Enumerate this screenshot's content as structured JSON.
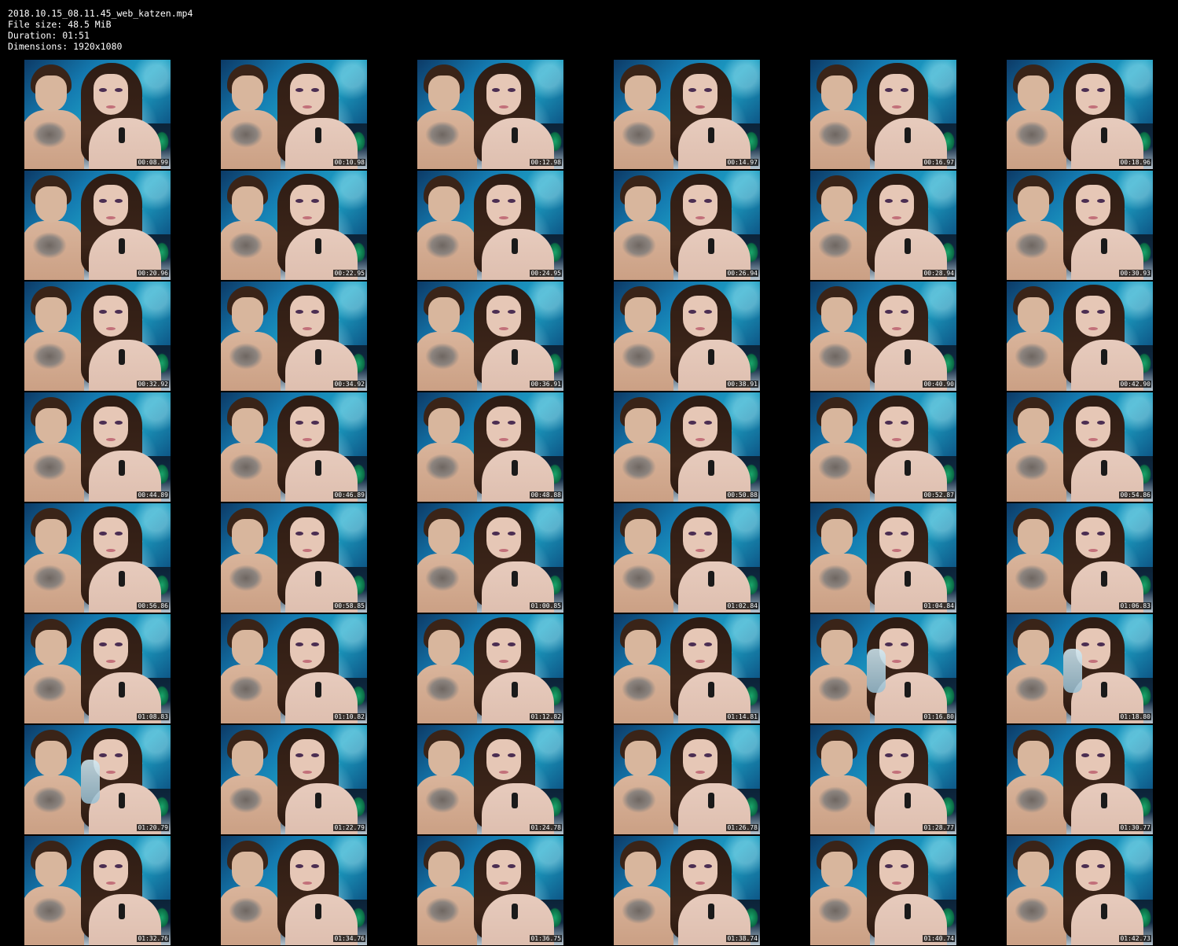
{
  "header": {
    "filename": "2018.10.15_08.11.45_web_katzen.mp4",
    "file_size_label": "File size:",
    "file_size": "48.5 MiB",
    "duration_label": "Duration:",
    "duration": "01:51",
    "dimensions_label": "Dimensions:",
    "dimensions": "1920x1080"
  },
  "thumbnails": [
    {
      "timestamp": "00:08.99"
    },
    {
      "timestamp": "00:10.98"
    },
    {
      "timestamp": "00:12.98"
    },
    {
      "timestamp": "00:14.97"
    },
    {
      "timestamp": "00:16.97"
    },
    {
      "timestamp": "00:18.96"
    },
    {
      "timestamp": "00:20.96"
    },
    {
      "timestamp": "00:22.95"
    },
    {
      "timestamp": "00:24.95"
    },
    {
      "timestamp": "00:26.94"
    },
    {
      "timestamp": "00:28.94"
    },
    {
      "timestamp": "00:30.93"
    },
    {
      "timestamp": "00:32.92"
    },
    {
      "timestamp": "00:34.92"
    },
    {
      "timestamp": "00:36.91"
    },
    {
      "timestamp": "00:38.91"
    },
    {
      "timestamp": "00:40.90"
    },
    {
      "timestamp": "00:42.90"
    },
    {
      "timestamp": "00:44.89"
    },
    {
      "timestamp": "00:46.89"
    },
    {
      "timestamp": "00:48.88"
    },
    {
      "timestamp": "00:50.88"
    },
    {
      "timestamp": "00:52.87"
    },
    {
      "timestamp": "00:54.86"
    },
    {
      "timestamp": "00:56.86"
    },
    {
      "timestamp": "00:58.85"
    },
    {
      "timestamp": "01:00.85"
    },
    {
      "timestamp": "01:02.84"
    },
    {
      "timestamp": "01:04.84"
    },
    {
      "timestamp": "01:06.83"
    },
    {
      "timestamp": "01:08.83"
    },
    {
      "timestamp": "01:10.82"
    },
    {
      "timestamp": "01:12.82"
    },
    {
      "timestamp": "01:14.81"
    },
    {
      "timestamp": "01:16.80",
      "bottle": true
    },
    {
      "timestamp": "01:18.80",
      "bottle": true
    },
    {
      "timestamp": "01:20.79",
      "bottle": true
    },
    {
      "timestamp": "01:22.79"
    },
    {
      "timestamp": "01:24.78"
    },
    {
      "timestamp": "01:26.78"
    },
    {
      "timestamp": "01:28.77"
    },
    {
      "timestamp": "01:30.77"
    },
    {
      "timestamp": "01:32.76"
    },
    {
      "timestamp": "01:34.76"
    },
    {
      "timestamp": "01:36.75"
    },
    {
      "timestamp": "01:38.74"
    },
    {
      "timestamp": "01:40.74"
    },
    {
      "timestamp": "01:42.73"
    }
  ]
}
